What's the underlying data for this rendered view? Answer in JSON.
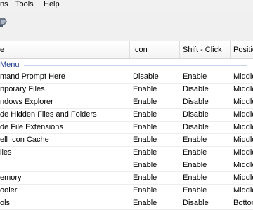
{
  "menubar": {
    "items": [
      "ns",
      "Tools",
      "Help"
    ]
  },
  "toolbar": {
    "icon": "tools-icon"
  },
  "table": {
    "columns": [
      "e",
      "Icon",
      "Shift - Click",
      "Positio"
    ],
    "group_label": "Menu",
    "rows": [
      [
        "mand Prompt Here",
        "Disable",
        "Enable",
        "Middle"
      ],
      [
        "nporary Files",
        "Enable",
        "Disable",
        "Middle"
      ],
      [
        "ndows Explorer",
        "Enable",
        "Disable",
        "Middle"
      ],
      [
        "de Hidden Files and Folders",
        "Enable",
        "Disable",
        "Middle"
      ],
      [
        "de File Extensions",
        "Enable",
        "Disable",
        "Middle"
      ],
      [
        "ell Icon Cache",
        "Enable",
        "Enable",
        "Middle"
      ],
      [
        "iles",
        "Enable",
        "Enable",
        "Middle"
      ],
      [
        "",
        "Enable",
        "Enable",
        "Middle"
      ],
      [
        "emory",
        "Enable",
        "Enable",
        "Middle"
      ],
      [
        "ooler",
        "Enable",
        "Enable",
        "Middle"
      ],
      [
        "ols",
        "Enable",
        "Disable",
        "Bottom"
      ]
    ]
  }
}
